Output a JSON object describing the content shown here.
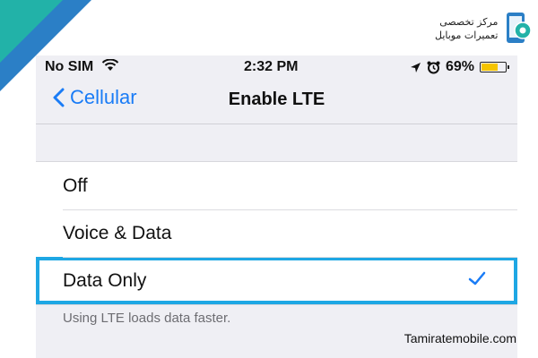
{
  "status_bar": {
    "carrier": "No SIM",
    "time": "2:32 PM",
    "battery_percent": "69%",
    "battery_level": 0.69,
    "icons": [
      "wifi-icon",
      "location-arrow-icon",
      "alarm-icon",
      "battery-icon"
    ]
  },
  "nav": {
    "back_label": "Cellular",
    "title": "Enable LTE"
  },
  "options": [
    {
      "label": "Off",
      "selected": false
    },
    {
      "label": "Voice & Data",
      "selected": false
    },
    {
      "label": "Data Only",
      "selected": true
    }
  ],
  "footer_note": "Using LTE loads data faster.",
  "branding": {
    "logo_line1": "مرکز تخصصی",
    "logo_line2": "تعمیرات موبایل",
    "watermark": "Tamiratemobile.com"
  },
  "colors": {
    "accent": "#1a7cf6",
    "highlight_border": "#1ea7e4",
    "background": "#efeff4",
    "battery_fill": "#f5c400"
  }
}
